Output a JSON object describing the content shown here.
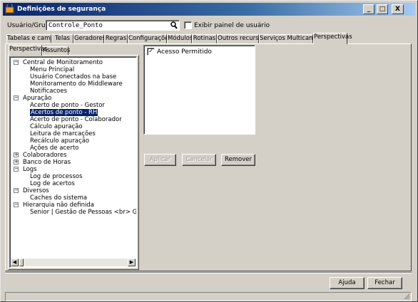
{
  "window": {
    "title": "Definições de segurança",
    "minimize_label": "_",
    "maximize_label": "□",
    "close_label": "X"
  },
  "user_group": {
    "label": "Usuário/Grupo:",
    "value": "Controle_Ponto",
    "show_panel_label": "Exibir painel de usuário",
    "show_panel_checked": false
  },
  "tabs": [
    {
      "label": "Tabelas e campos"
    },
    {
      "label": "Telas"
    },
    {
      "label": "Geradores"
    },
    {
      "label": "Regras"
    },
    {
      "label": "Configurações"
    },
    {
      "label": "Módulos"
    },
    {
      "label": "Rotinas"
    },
    {
      "label": "Outros recursos"
    },
    {
      "label": "Serviços Multicamada"
    },
    {
      "label": "Perspectivas",
      "selected": true
    }
  ],
  "subtabs": [
    {
      "label": "Perspectivas",
      "selected": true
    },
    {
      "label": "Assuntos"
    }
  ],
  "tree": [
    {
      "label": "Central de Monitoramento",
      "level": 0,
      "expander": "−"
    },
    {
      "label": "Menu Principal",
      "level": 1
    },
    {
      "label": "Usuário Conectados na base",
      "level": 1
    },
    {
      "label": "Monitoramento do Middleware",
      "level": 1
    },
    {
      "label": "Notificacoes",
      "level": 1
    },
    {
      "label": "Apuração",
      "level": 0,
      "expander": "−"
    },
    {
      "label": "Acerto de ponto - Gestor",
      "level": 1
    },
    {
      "label": "Acertos de ponto - RH",
      "level": 1,
      "selected": true
    },
    {
      "label": "Acerto de ponto - Colaborador",
      "level": 1
    },
    {
      "label": "Cálculo apuração",
      "level": 1
    },
    {
      "label": "Leitura de marcações",
      "level": 1
    },
    {
      "label": "Recálculo apuração",
      "level": 1
    },
    {
      "label": "Ações de acerto",
      "level": 1
    },
    {
      "label": "Colaboradores",
      "level": 0,
      "expander": "+"
    },
    {
      "label": "Banco de Horas",
      "level": 0,
      "expander": "+"
    },
    {
      "label": "Logs",
      "level": 0,
      "expander": "−"
    },
    {
      "label": "Log de processos",
      "level": 1
    },
    {
      "label": "Log de acertos",
      "level": 1
    },
    {
      "label": "Diversos",
      "level": 0,
      "expander": "−"
    },
    {
      "label": "Caches do sistema",
      "level": 1
    },
    {
      "label": "Hierarquia não definida",
      "level": 0,
      "expander": "−"
    },
    {
      "label": "Senior | Gestão de Pessoas <br> Gestão do Ponto",
      "level": 1
    }
  ],
  "permissions": {
    "access_label": "Acesso Permitido",
    "access_checked": true
  },
  "buttons": {
    "apply": "Aplicar",
    "cancel": "Cancelar",
    "remove": "Remover",
    "help": "Ajuda",
    "close": "Fechar"
  },
  "colors": {
    "titlebar": "#0a246a",
    "face": "#d4d0c8",
    "selection": "#0a246a"
  }
}
